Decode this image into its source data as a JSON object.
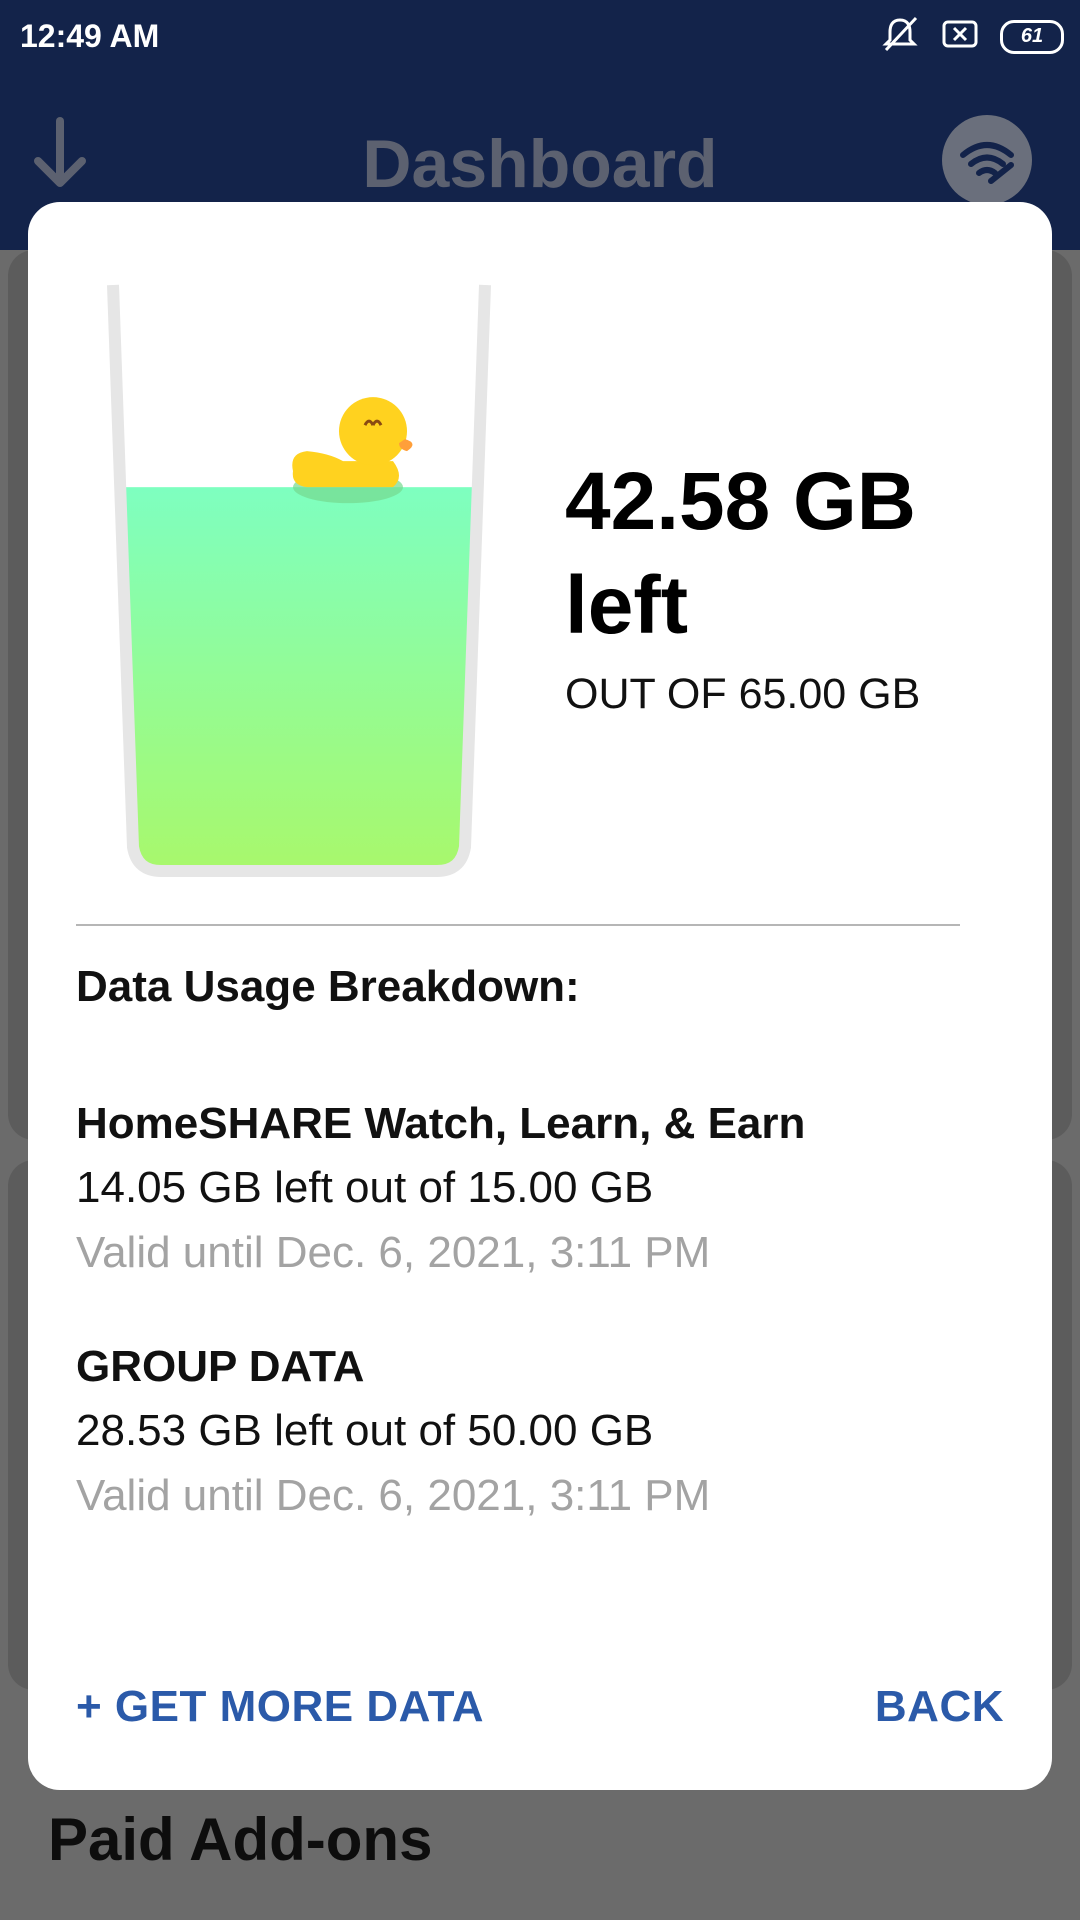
{
  "status_bar": {
    "time": "12:49 AM",
    "battery": "61",
    "icons": [
      "muted-bell-icon",
      "close-box-icon",
      "battery-icon"
    ]
  },
  "app_bar": {
    "title": "Dashboard",
    "left_icon": "download-arrow-icon",
    "right_icon": "wifi-wrench-icon"
  },
  "background": {
    "section_heading": "Paid Add-ons"
  },
  "dialog": {
    "glass": {
      "fill_fraction": 0.655,
      "icon": "rubber-duck-icon"
    },
    "summary": {
      "amount_left": "42.58 GB",
      "left_label": "left",
      "out_of": "OUT OF 65.00 GB"
    },
    "breakdown_title": "Data Usage Breakdown:",
    "items": [
      {
        "name": "HomeSHARE Watch, Learn, & Earn",
        "amount": "14.05 GB left out of 15.00 GB",
        "valid": "Valid until Dec. 6, 2021, 3:11 PM"
      },
      {
        "name": "GROUP DATA",
        "amount": "28.53 GB left out of 50.00 GB",
        "valid": "Valid until Dec. 6, 2021, 3:11 PM"
      }
    ],
    "buttons": {
      "get_more": "+ GET MORE DATA",
      "back": "BACK"
    }
  },
  "colors": {
    "header_bg": "#13234a",
    "accent": "#2b5aa9",
    "water_top": "#7effc0",
    "water_bottom": "#a9f86a",
    "duck": "#ffd21f",
    "muted_text": "#a3a3a3"
  }
}
